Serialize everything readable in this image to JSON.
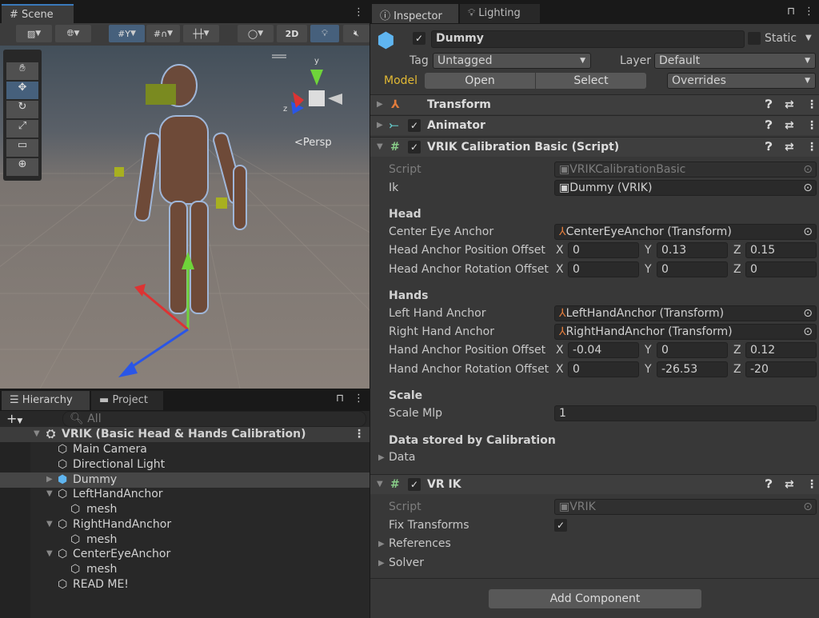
{
  "scene": {
    "tab": "Scene",
    "btn_2d": "2D",
    "persp": "<Persp",
    "axis_x": "x",
    "axis_y": "y",
    "axis_z": "z"
  },
  "hierarchy": {
    "tab": "Hierarchy",
    "project_tab": "Project",
    "search_placeholder": "All",
    "root": "VRIK (Basic Head & Hands Calibration)",
    "items": [
      "Main Camera",
      "Directional Light",
      "Dummy",
      "LeftHandAnchor",
      "mesh",
      "RightHandAnchor",
      "mesh",
      "CenterEyeAnchor",
      "mesh",
      "READ ME!"
    ]
  },
  "inspector": {
    "tab": "Inspector",
    "lighting_tab": "Lighting",
    "object_name": "Dummy",
    "static_label": "Static",
    "tag_label": "Tag",
    "tag_value": "Untagged",
    "layer_label": "Layer",
    "layer_value": "Default",
    "model_label": "Model",
    "open": "Open",
    "select": "Select",
    "overrides": "Overrides",
    "components": {
      "transform": "Transform",
      "animator": "Animator",
      "vrik_calib": "VRIK Calibration Basic (Script)",
      "vrik": "VR IK"
    },
    "calib": {
      "script_label": "Script",
      "script_value": "VRIKCalibrationBasic",
      "ik_label": "Ik",
      "ik_value": "Dummy (VRIK)",
      "head_section": "Head",
      "center_eye_label": "Center Eye Anchor",
      "center_eye_value": "CenterEyeAnchor (Transform)",
      "head_pos_label": "Head Anchor Position Offset",
      "head_pos": {
        "x": "0",
        "y": "0.13",
        "z": "0.15"
      },
      "head_rot_label": "Head Anchor Rotation Offset",
      "head_rot": {
        "x": "0",
        "y": "0",
        "z": "0"
      },
      "hands_section": "Hands",
      "left_label": "Left Hand Anchor",
      "left_value": "LeftHandAnchor (Transform)",
      "right_label": "Right Hand Anchor",
      "right_value": "RightHandAnchor (Transform)",
      "hand_pos_label": "Hand Anchor Position Offset",
      "hand_pos": {
        "x": "-0.04",
        "y": "0",
        "z": "0.12"
      },
      "hand_rot_label": "Hand Anchor Rotation Offset",
      "hand_rot": {
        "x": "0",
        "y": "-26.53",
        "z": "-20"
      },
      "scale_section": "Scale",
      "scale_label": "Scale Mlp",
      "scale_value": "1",
      "data_section": "Data stored by Calibration",
      "data_label": "Data"
    },
    "vrik": {
      "script_label": "Script",
      "script_value": "VRIK",
      "fix_label": "Fix Transforms",
      "references": "References",
      "solver": "Solver"
    },
    "add_component": "Add Component",
    "xyz_labels": {
      "x": "X",
      "y": "Y",
      "z": "Z"
    }
  },
  "colors": {
    "model_label": "#e2b934",
    "selected_tool": "#46607c",
    "panel": "#383838"
  }
}
